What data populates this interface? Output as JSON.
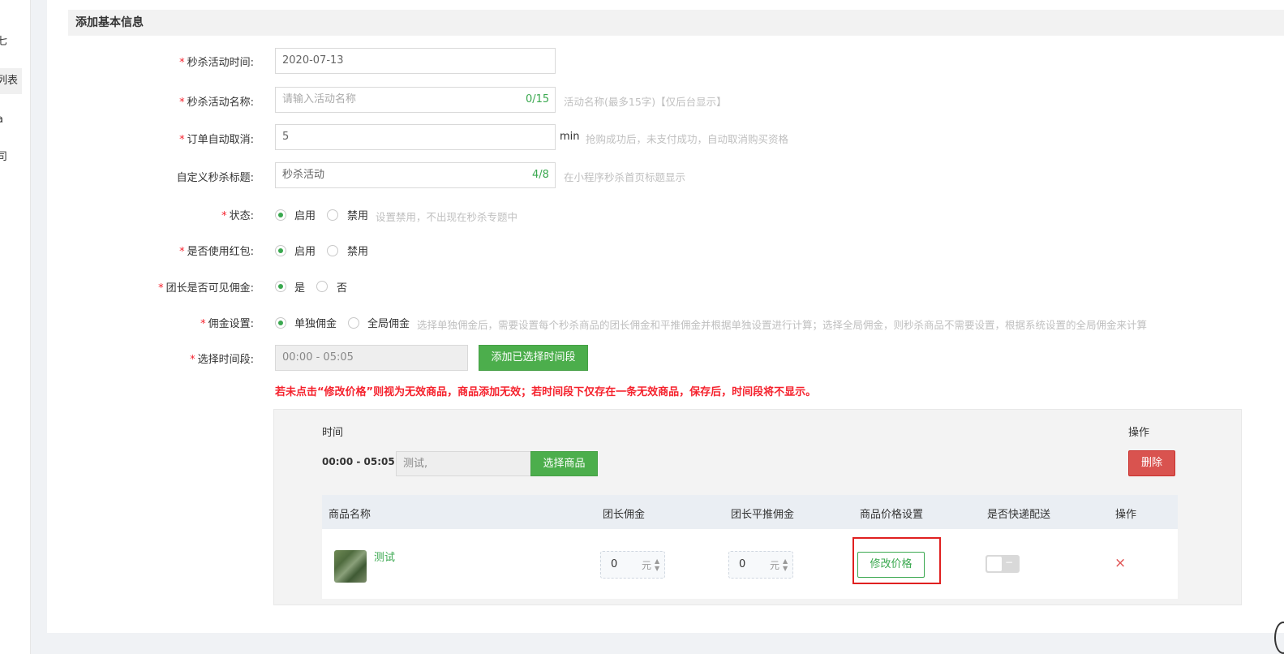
{
  "sidebar": {
    "items": [
      {
        "label": "七"
      },
      {
        "label": "列表"
      },
      {
        "label": "a"
      },
      {
        "label": "司"
      }
    ]
  },
  "section": {
    "title": "添加基本信息"
  },
  "form": {
    "required_mark": "*",
    "activity_time": {
      "label": "秒杀活动时间:",
      "value": "2020-07-13"
    },
    "activity_name": {
      "label": "秒杀活动名称:",
      "placeholder": "请输入活动名称",
      "counter": "0/15",
      "hint": "活动名称(最多15字)【仅后台显示】"
    },
    "auto_cancel": {
      "label": "订单自动取消:",
      "value": "5",
      "unit": "min",
      "hint": "抢购成功后，未支付成功，自动取消购买资格"
    },
    "custom_title": {
      "label": "自定义秒杀标题:",
      "value": "秒杀活动",
      "counter": "4/8",
      "hint": "在小程序秒杀首页标题显示"
    },
    "status": {
      "label": "状态:",
      "options": [
        "启用",
        "禁用"
      ],
      "selected": "启用",
      "hint": "设置禁用，不出现在秒杀专题中"
    },
    "red_packet": {
      "label": "是否使用红包:",
      "options": [
        "启用",
        "禁用"
      ],
      "selected": "启用"
    },
    "leader_commission_visible": {
      "label": "团长是否可见佣金:",
      "options": [
        "是",
        "否"
      ],
      "selected": "是"
    },
    "commission_setting": {
      "label": "佣金设置:",
      "options": [
        "单独佣金",
        "全局佣金"
      ],
      "selected": "单独佣金",
      "hint": "选择单独佣金后，需要设置每个秒杀商品的团长佣金和平推佣金并根据单独设置进行计算；选择全局佣金，则秒杀商品不需要设置，根据系统设置的全局佣金来计算"
    },
    "time_slot": {
      "label": "选择时间段:",
      "value": "00:00 - 05:05",
      "add_button": "添加已选择时间段"
    }
  },
  "warning": "若未点击“修改价格”则视为无效商品，商品添加无效；若时间段下仅存在一条无效商品，保存后，时间段将不显示。",
  "time_table": {
    "header_time": "时间",
    "header_action": "操作",
    "row_time": "00:00 - 05:05",
    "goods_input_value": "测试,",
    "select_goods_button": "选择商品",
    "delete_button": "删除",
    "goods_columns": [
      "商品名称",
      "团长佣金",
      "团长平推佣金",
      "商品价格设置",
      "是否快递配送",
      "操作"
    ],
    "goods_rows": [
      {
        "name": "测试",
        "leader_commission": "0",
        "flat_commission": "0",
        "currency_unit": "元",
        "price_button": "修改价格",
        "express_delivery": false,
        "express_label": "−",
        "remove_icon": "×"
      }
    ]
  },
  "colors": {
    "accent_green": "#3aa84f",
    "danger_red": "#d9534f",
    "warning_red": "#f5222d",
    "highlight_red": "#e02020"
  }
}
